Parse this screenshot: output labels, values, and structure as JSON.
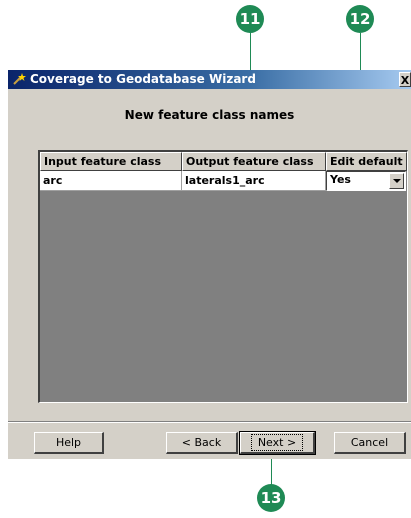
{
  "callouts": [
    {
      "number": "11"
    },
    {
      "number": "12"
    },
    {
      "number": "13"
    }
  ],
  "window": {
    "title": "Coverage to Geodatabase Wizard",
    "close_glyph": "X",
    "heading": "New feature class names"
  },
  "table": {
    "columns": [
      "Input feature class",
      "Output feature class",
      "Edit default"
    ],
    "rows": [
      {
        "input": "arc",
        "output": "laterals1_arc",
        "edit_default": "Yes"
      }
    ]
  },
  "buttons": {
    "help": "Help",
    "back": "< Back",
    "next": "Next >",
    "cancel": "Cancel"
  },
  "colors": {
    "callout": "#1f8a55",
    "title_bar_start": "#0a246a",
    "dialog_bg": "#d4d0c8",
    "grid_bg": "#808080"
  }
}
